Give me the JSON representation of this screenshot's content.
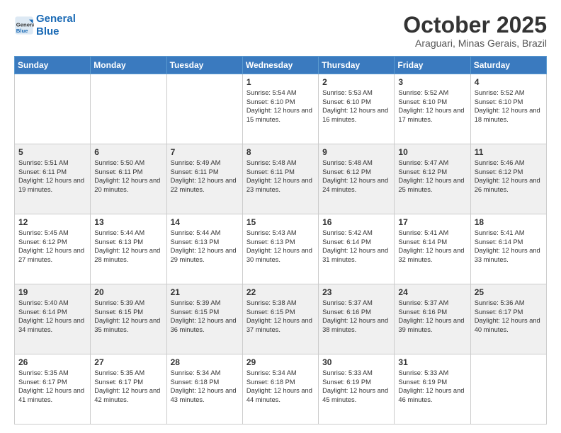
{
  "header": {
    "logo_line1": "General",
    "logo_line2": "Blue",
    "month": "October 2025",
    "location": "Araguari, Minas Gerais, Brazil"
  },
  "days_of_week": [
    "Sunday",
    "Monday",
    "Tuesday",
    "Wednesday",
    "Thursday",
    "Friday",
    "Saturday"
  ],
  "weeks": [
    [
      {
        "day": "",
        "text": ""
      },
      {
        "day": "",
        "text": ""
      },
      {
        "day": "",
        "text": ""
      },
      {
        "day": "1",
        "text": "Sunrise: 5:54 AM\nSunset: 6:10 PM\nDaylight: 12 hours\nand 15 minutes."
      },
      {
        "day": "2",
        "text": "Sunrise: 5:53 AM\nSunset: 6:10 PM\nDaylight: 12 hours\nand 16 minutes."
      },
      {
        "day": "3",
        "text": "Sunrise: 5:52 AM\nSunset: 6:10 PM\nDaylight: 12 hours\nand 17 minutes."
      },
      {
        "day": "4",
        "text": "Sunrise: 5:52 AM\nSunset: 6:10 PM\nDaylight: 12 hours\nand 18 minutes."
      }
    ],
    [
      {
        "day": "5",
        "text": "Sunrise: 5:51 AM\nSunset: 6:11 PM\nDaylight: 12 hours\nand 19 minutes."
      },
      {
        "day": "6",
        "text": "Sunrise: 5:50 AM\nSunset: 6:11 PM\nDaylight: 12 hours\nand 20 minutes."
      },
      {
        "day": "7",
        "text": "Sunrise: 5:49 AM\nSunset: 6:11 PM\nDaylight: 12 hours\nand 22 minutes."
      },
      {
        "day": "8",
        "text": "Sunrise: 5:48 AM\nSunset: 6:11 PM\nDaylight: 12 hours\nand 23 minutes."
      },
      {
        "day": "9",
        "text": "Sunrise: 5:48 AM\nSunset: 6:12 PM\nDaylight: 12 hours\nand 24 minutes."
      },
      {
        "day": "10",
        "text": "Sunrise: 5:47 AM\nSunset: 6:12 PM\nDaylight: 12 hours\nand 25 minutes."
      },
      {
        "day": "11",
        "text": "Sunrise: 5:46 AM\nSunset: 6:12 PM\nDaylight: 12 hours\nand 26 minutes."
      }
    ],
    [
      {
        "day": "12",
        "text": "Sunrise: 5:45 AM\nSunset: 6:12 PM\nDaylight: 12 hours\nand 27 minutes."
      },
      {
        "day": "13",
        "text": "Sunrise: 5:44 AM\nSunset: 6:13 PM\nDaylight: 12 hours\nand 28 minutes."
      },
      {
        "day": "14",
        "text": "Sunrise: 5:44 AM\nSunset: 6:13 PM\nDaylight: 12 hours\nand 29 minutes."
      },
      {
        "day": "15",
        "text": "Sunrise: 5:43 AM\nSunset: 6:13 PM\nDaylight: 12 hours\nand 30 minutes."
      },
      {
        "day": "16",
        "text": "Sunrise: 5:42 AM\nSunset: 6:14 PM\nDaylight: 12 hours\nand 31 minutes."
      },
      {
        "day": "17",
        "text": "Sunrise: 5:41 AM\nSunset: 6:14 PM\nDaylight: 12 hours\nand 32 minutes."
      },
      {
        "day": "18",
        "text": "Sunrise: 5:41 AM\nSunset: 6:14 PM\nDaylight: 12 hours\nand 33 minutes."
      }
    ],
    [
      {
        "day": "19",
        "text": "Sunrise: 5:40 AM\nSunset: 6:14 PM\nDaylight: 12 hours\nand 34 minutes."
      },
      {
        "day": "20",
        "text": "Sunrise: 5:39 AM\nSunset: 6:15 PM\nDaylight: 12 hours\nand 35 minutes."
      },
      {
        "day": "21",
        "text": "Sunrise: 5:39 AM\nSunset: 6:15 PM\nDaylight: 12 hours\nand 36 minutes."
      },
      {
        "day": "22",
        "text": "Sunrise: 5:38 AM\nSunset: 6:15 PM\nDaylight: 12 hours\nand 37 minutes."
      },
      {
        "day": "23",
        "text": "Sunrise: 5:37 AM\nSunset: 6:16 PM\nDaylight: 12 hours\nand 38 minutes."
      },
      {
        "day": "24",
        "text": "Sunrise: 5:37 AM\nSunset: 6:16 PM\nDaylight: 12 hours\nand 39 minutes."
      },
      {
        "day": "25",
        "text": "Sunrise: 5:36 AM\nSunset: 6:17 PM\nDaylight: 12 hours\nand 40 minutes."
      }
    ],
    [
      {
        "day": "26",
        "text": "Sunrise: 5:35 AM\nSunset: 6:17 PM\nDaylight: 12 hours\nand 41 minutes."
      },
      {
        "day": "27",
        "text": "Sunrise: 5:35 AM\nSunset: 6:17 PM\nDaylight: 12 hours\nand 42 minutes."
      },
      {
        "day": "28",
        "text": "Sunrise: 5:34 AM\nSunset: 6:18 PM\nDaylight: 12 hours\nand 43 minutes."
      },
      {
        "day": "29",
        "text": "Sunrise: 5:34 AM\nSunset: 6:18 PM\nDaylight: 12 hours\nand 44 minutes."
      },
      {
        "day": "30",
        "text": "Sunrise: 5:33 AM\nSunset: 6:19 PM\nDaylight: 12 hours\nand 45 minutes."
      },
      {
        "day": "31",
        "text": "Sunrise: 5:33 AM\nSunset: 6:19 PM\nDaylight: 12 hours\nand 46 minutes."
      },
      {
        "day": "",
        "text": ""
      }
    ]
  ]
}
